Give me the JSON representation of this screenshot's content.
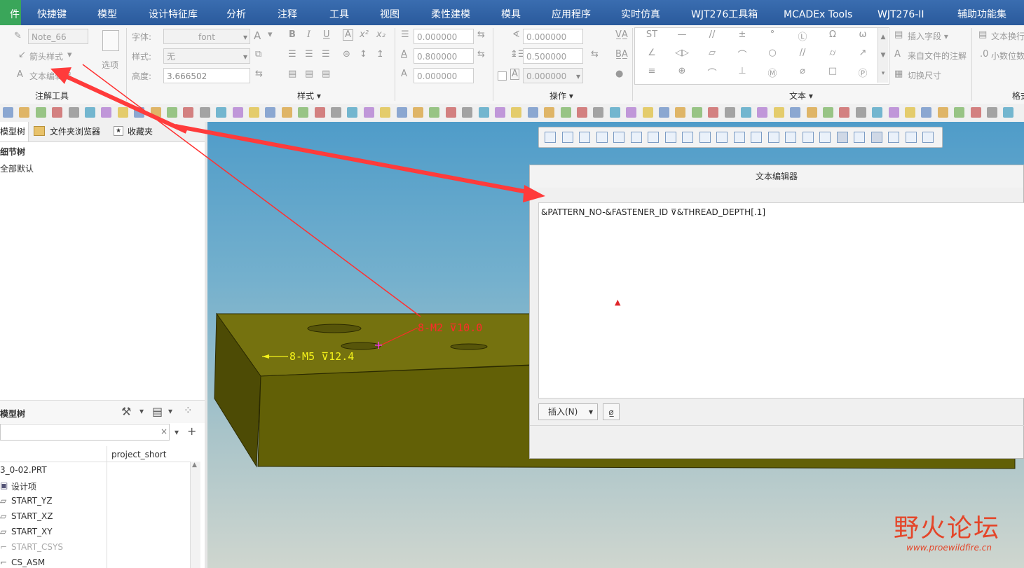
{
  "menu": {
    "file": "件",
    "items": [
      "快捷键",
      "模型",
      "设计特征库",
      "分析",
      "注释",
      "工具",
      "视图",
      "柔性建模",
      "模具",
      "应用程序",
      "实时仿真",
      "WJT276工具箱",
      "MCADEx Tools",
      "WJT276-II",
      "辅助功能集"
    ]
  },
  "ribbon": {
    "annotation_tools": {
      "note_name": "Note_66",
      "arrow_style": "箭头样式",
      "text_editor": "文本编辑器",
      "options": "选项",
      "group_title": "注解工具"
    },
    "style": {
      "font_label": "字体:",
      "font_value": "font",
      "style_label": "样式:",
      "style_value": "无",
      "height_label": "高度:",
      "height_value": "3.666502",
      "group_title": "样式"
    },
    "format": {
      "bold": "B",
      "italic": "I",
      "underline": "U",
      "boxed": "A",
      "superscript": "x²",
      "subscript": "x₂",
      "line_spacing": "0.000000",
      "width_factor": "0.800000",
      "char_spacing": "0.000000"
    },
    "operations": {
      "slant_angle": "0.000000",
      "line_spacing": "0.500000",
      "extra": "0.000000",
      "group_title": "操作"
    },
    "text_group": {
      "symbols": [
        "ST",
        "—",
        "//",
        "±",
        "°",
        "Ⓛ",
        "Ω",
        "ω",
        "∠",
        "◁▷",
        "▱",
        "⌒",
        "○",
        "//",
        "⌭",
        "↗",
        "≡",
        "⊕",
        "⌒",
        "⊥",
        "Ⓜ",
        "⌀",
        "□",
        "Ⓟ"
      ],
      "insert_field": "插入字段",
      "from_file_note": "来自文件的注解",
      "toggle_dim": "切换尺寸",
      "group_title": "文本"
    },
    "right_group": {
      "text_wrap": "文本换行",
      "decimal_places": "小数位数",
      "group_title": "格式"
    }
  },
  "left_panel": {
    "tabs": [
      "模型树",
      "文件夹浏览器",
      "收藏夹"
    ],
    "detail_tree_title": "细节树",
    "detail_tree_item": "全部默认",
    "model_tree_title": "模型树",
    "column_header": "project_short",
    "items": [
      "3_0-02.PRT",
      "设计项",
      "START_YZ",
      "START_XZ",
      "START_XY",
      "START_CSYS",
      "CS_ASM"
    ]
  },
  "viewport": {
    "annotation_red": "8-M2 ⊽10.0",
    "annotation_yellow": "8-M5 ⊽12.4"
  },
  "dialog": {
    "title": "文本编辑器",
    "text": "&PATTERN_NO-&FASTENER_ID ⊽&THREAD_DEPTH[.1]",
    "insert_label": "插入(N)"
  },
  "watermark": {
    "brand": "野火论坛",
    "url": "www.proewildfire.cn"
  },
  "colors": {
    "menubar": "#2a5a9c",
    "file_tab": "#3aa65a",
    "part_top": "#6f6d0d",
    "part_front": "#5c5a06",
    "arrow": "#ff3b3b",
    "annotation_yellow": "#f4f21a"
  }
}
